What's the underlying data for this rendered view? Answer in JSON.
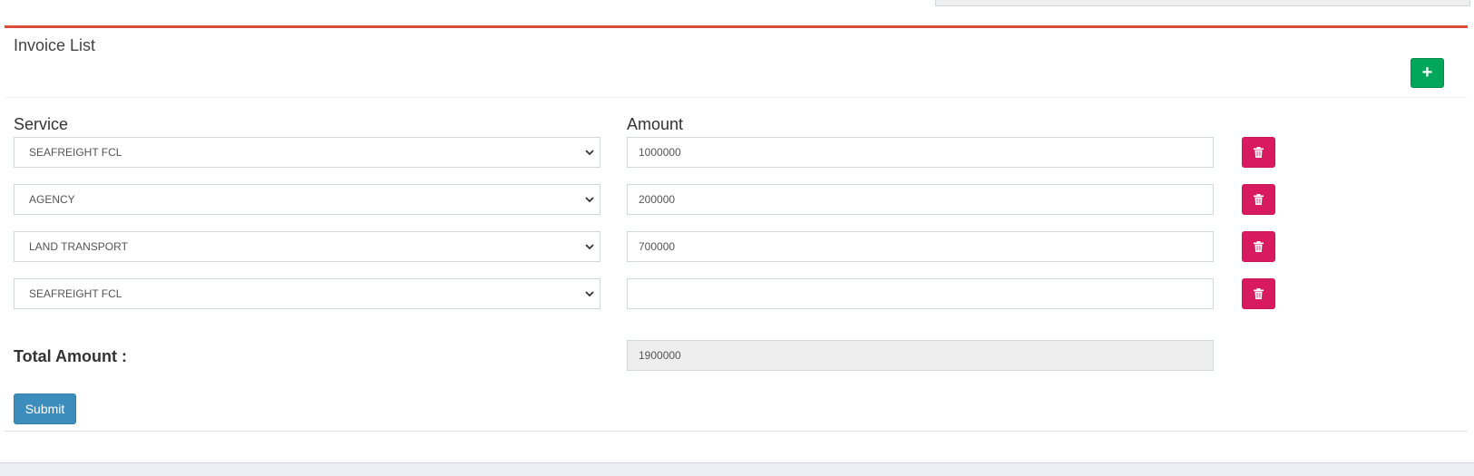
{
  "box": {
    "title": "Invoice List",
    "add_button": "+"
  },
  "columns": {
    "service": "Service",
    "amount": "Amount"
  },
  "rows": [
    {
      "service": "SEAFREIGHT FCL",
      "amount": "1000000"
    },
    {
      "service": "AGENCY",
      "amount": "200000"
    },
    {
      "service": "LAND TRANSPORT",
      "amount": "700000"
    },
    {
      "service": "SEAFREIGHT FCL",
      "amount": ""
    }
  ],
  "total": {
    "label": "Total Amount :",
    "value": "1900000"
  },
  "submit_label": "Submit",
  "colors": {
    "box_top_border": "#dd4b39",
    "add_button": "#00a65a",
    "delete_button": "#d81b60",
    "submit_button": "#3c8dbc"
  },
  "icons": {
    "add": "plus-icon",
    "delete": "trash-icon",
    "select": "chevron-down-icon"
  }
}
